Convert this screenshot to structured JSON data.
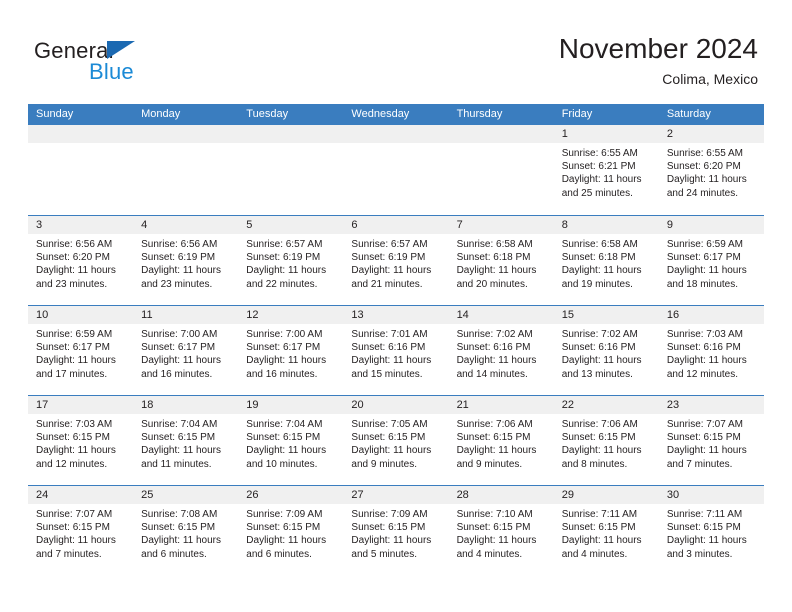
{
  "brand": {
    "name_part1": "General",
    "name_part2": "Blue"
  },
  "header": {
    "title": "November 2024",
    "subtitle": "Colima, Mexico"
  },
  "colors": {
    "header_blue": "#3a7dbf",
    "logo_blue": "#1b8ad6",
    "logo_triangle": "#1b69b2",
    "daynum_band": "#f0f0f0",
    "text": "#231f20"
  },
  "weekdays": [
    "Sunday",
    "Monday",
    "Tuesday",
    "Wednesday",
    "Thursday",
    "Friday",
    "Saturday"
  ],
  "weeks": [
    [
      {
        "day": "",
        "sunrise": "",
        "sunset": "",
        "daylight": "",
        "empty": true
      },
      {
        "day": "",
        "sunrise": "",
        "sunset": "",
        "daylight": "",
        "empty": true
      },
      {
        "day": "",
        "sunrise": "",
        "sunset": "",
        "daylight": "",
        "empty": true
      },
      {
        "day": "",
        "sunrise": "",
        "sunset": "",
        "daylight": "",
        "empty": true
      },
      {
        "day": "",
        "sunrise": "",
        "sunset": "",
        "daylight": "",
        "empty": true
      },
      {
        "day": "1",
        "sunrise": "Sunrise: 6:55 AM",
        "sunset": "Sunset: 6:21 PM",
        "daylight": "Daylight: 11 hours and 25 minutes."
      },
      {
        "day": "2",
        "sunrise": "Sunrise: 6:55 AM",
        "sunset": "Sunset: 6:20 PM",
        "daylight": "Daylight: 11 hours and 24 minutes."
      }
    ],
    [
      {
        "day": "3",
        "sunrise": "Sunrise: 6:56 AM",
        "sunset": "Sunset: 6:20 PM",
        "daylight": "Daylight: 11 hours and 23 minutes."
      },
      {
        "day": "4",
        "sunrise": "Sunrise: 6:56 AM",
        "sunset": "Sunset: 6:19 PM",
        "daylight": "Daylight: 11 hours and 23 minutes."
      },
      {
        "day": "5",
        "sunrise": "Sunrise: 6:57 AM",
        "sunset": "Sunset: 6:19 PM",
        "daylight": "Daylight: 11 hours and 22 minutes."
      },
      {
        "day": "6",
        "sunrise": "Sunrise: 6:57 AM",
        "sunset": "Sunset: 6:19 PM",
        "daylight": "Daylight: 11 hours and 21 minutes."
      },
      {
        "day": "7",
        "sunrise": "Sunrise: 6:58 AM",
        "sunset": "Sunset: 6:18 PM",
        "daylight": "Daylight: 11 hours and 20 minutes."
      },
      {
        "day": "8",
        "sunrise": "Sunrise: 6:58 AM",
        "sunset": "Sunset: 6:18 PM",
        "daylight": "Daylight: 11 hours and 19 minutes."
      },
      {
        "day": "9",
        "sunrise": "Sunrise: 6:59 AM",
        "sunset": "Sunset: 6:17 PM",
        "daylight": "Daylight: 11 hours and 18 minutes."
      }
    ],
    [
      {
        "day": "10",
        "sunrise": "Sunrise: 6:59 AM",
        "sunset": "Sunset: 6:17 PM",
        "daylight": "Daylight: 11 hours and 17 minutes."
      },
      {
        "day": "11",
        "sunrise": "Sunrise: 7:00 AM",
        "sunset": "Sunset: 6:17 PM",
        "daylight": "Daylight: 11 hours and 16 minutes."
      },
      {
        "day": "12",
        "sunrise": "Sunrise: 7:00 AM",
        "sunset": "Sunset: 6:17 PM",
        "daylight": "Daylight: 11 hours and 16 minutes."
      },
      {
        "day": "13",
        "sunrise": "Sunrise: 7:01 AM",
        "sunset": "Sunset: 6:16 PM",
        "daylight": "Daylight: 11 hours and 15 minutes."
      },
      {
        "day": "14",
        "sunrise": "Sunrise: 7:02 AM",
        "sunset": "Sunset: 6:16 PM",
        "daylight": "Daylight: 11 hours and 14 minutes."
      },
      {
        "day": "15",
        "sunrise": "Sunrise: 7:02 AM",
        "sunset": "Sunset: 6:16 PM",
        "daylight": "Daylight: 11 hours and 13 minutes."
      },
      {
        "day": "16",
        "sunrise": "Sunrise: 7:03 AM",
        "sunset": "Sunset: 6:16 PM",
        "daylight": "Daylight: 11 hours and 12 minutes."
      }
    ],
    [
      {
        "day": "17",
        "sunrise": "Sunrise: 7:03 AM",
        "sunset": "Sunset: 6:15 PM",
        "daylight": "Daylight: 11 hours and 12 minutes."
      },
      {
        "day": "18",
        "sunrise": "Sunrise: 7:04 AM",
        "sunset": "Sunset: 6:15 PM",
        "daylight": "Daylight: 11 hours and 11 minutes."
      },
      {
        "day": "19",
        "sunrise": "Sunrise: 7:04 AM",
        "sunset": "Sunset: 6:15 PM",
        "daylight": "Daylight: 11 hours and 10 minutes."
      },
      {
        "day": "20",
        "sunrise": "Sunrise: 7:05 AM",
        "sunset": "Sunset: 6:15 PM",
        "daylight": "Daylight: 11 hours and 9 minutes."
      },
      {
        "day": "21",
        "sunrise": "Sunrise: 7:06 AM",
        "sunset": "Sunset: 6:15 PM",
        "daylight": "Daylight: 11 hours and 9 minutes."
      },
      {
        "day": "22",
        "sunrise": "Sunrise: 7:06 AM",
        "sunset": "Sunset: 6:15 PM",
        "daylight": "Daylight: 11 hours and 8 minutes."
      },
      {
        "day": "23",
        "sunrise": "Sunrise: 7:07 AM",
        "sunset": "Sunset: 6:15 PM",
        "daylight": "Daylight: 11 hours and 7 minutes."
      }
    ],
    [
      {
        "day": "24",
        "sunrise": "Sunrise: 7:07 AM",
        "sunset": "Sunset: 6:15 PM",
        "daylight": "Daylight: 11 hours and 7 minutes."
      },
      {
        "day": "25",
        "sunrise": "Sunrise: 7:08 AM",
        "sunset": "Sunset: 6:15 PM",
        "daylight": "Daylight: 11 hours and 6 minutes."
      },
      {
        "day": "26",
        "sunrise": "Sunrise: 7:09 AM",
        "sunset": "Sunset: 6:15 PM",
        "daylight": "Daylight: 11 hours and 6 minutes."
      },
      {
        "day": "27",
        "sunrise": "Sunrise: 7:09 AM",
        "sunset": "Sunset: 6:15 PM",
        "daylight": "Daylight: 11 hours and 5 minutes."
      },
      {
        "day": "28",
        "sunrise": "Sunrise: 7:10 AM",
        "sunset": "Sunset: 6:15 PM",
        "daylight": "Daylight: 11 hours and 4 minutes."
      },
      {
        "day": "29",
        "sunrise": "Sunrise: 7:11 AM",
        "sunset": "Sunset: 6:15 PM",
        "daylight": "Daylight: 11 hours and 4 minutes."
      },
      {
        "day": "30",
        "sunrise": "Sunrise: 7:11 AM",
        "sunset": "Sunset: 6:15 PM",
        "daylight": "Daylight: 11 hours and 3 minutes."
      }
    ]
  ]
}
